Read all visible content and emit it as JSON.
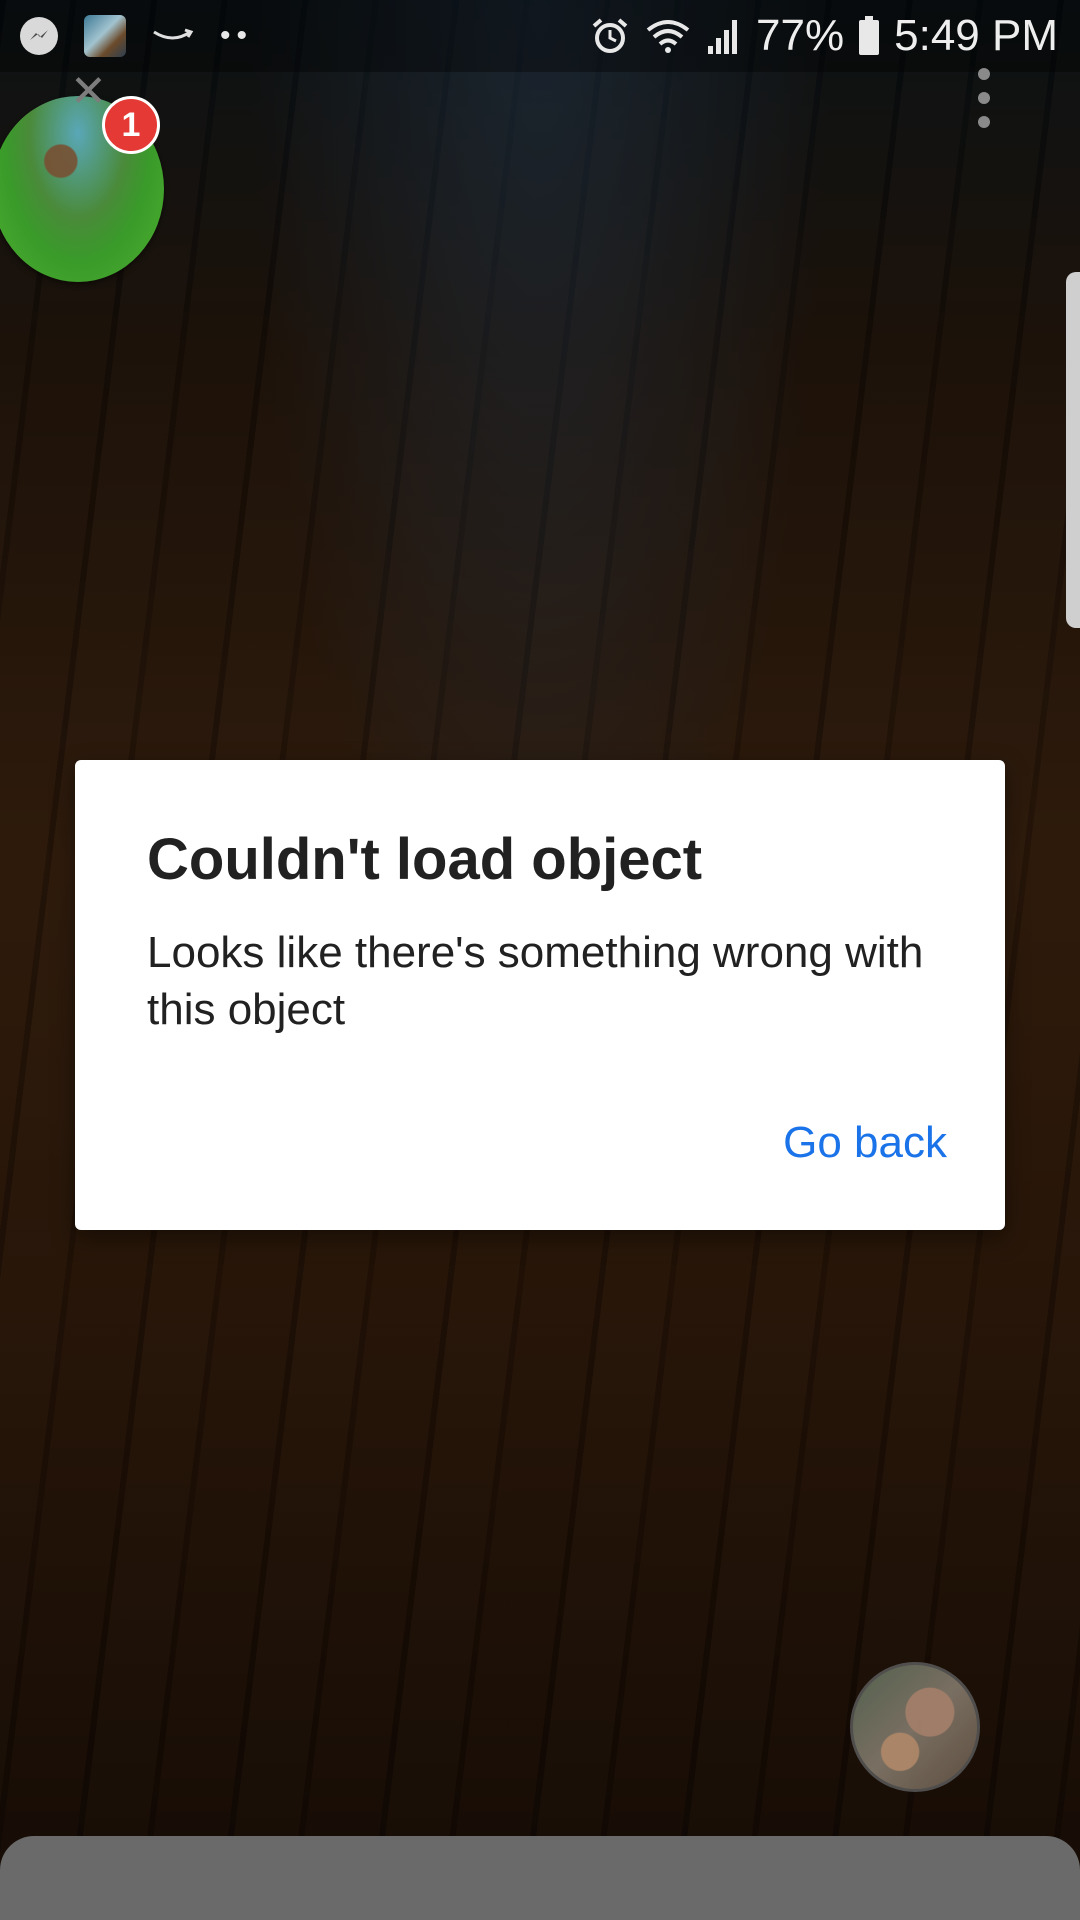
{
  "status_bar": {
    "icons_left": [
      "messenger-icon",
      "game-app-icon",
      "amazon-icon",
      "more-dots-icon"
    ],
    "icons_right": [
      "alarm-icon",
      "wifi-icon",
      "signal-icon",
      "battery-icon"
    ],
    "battery_text": "77%",
    "time": "5:49 PM"
  },
  "chat_head": {
    "badge_count": "1",
    "close_glyph": "✕"
  },
  "dialog": {
    "title": "Couldn't load object",
    "message": "Looks like there's something wrong with this object",
    "action_label": "Go back",
    "action_color": "#1a73e8"
  }
}
